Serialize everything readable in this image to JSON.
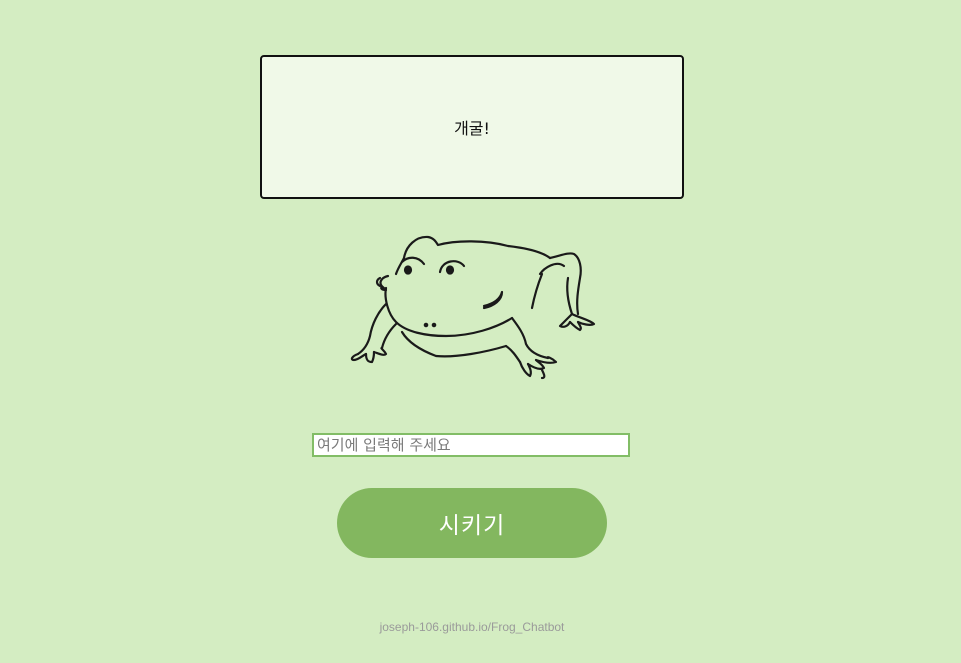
{
  "speech": {
    "text": "개굴!"
  },
  "frog": {
    "icon": "frog-illustration"
  },
  "input": {
    "placeholder": "여기에 입력해 주세요",
    "value": ""
  },
  "send_button": {
    "label": "시키기"
  },
  "footer": {
    "url": "joseph-106.github.io/Frog_Chatbot"
  },
  "colors": {
    "background": "#d4edc2",
    "speech_box": "#f0f9e8",
    "button": "#83b75f",
    "input_border": "#82bd66"
  }
}
